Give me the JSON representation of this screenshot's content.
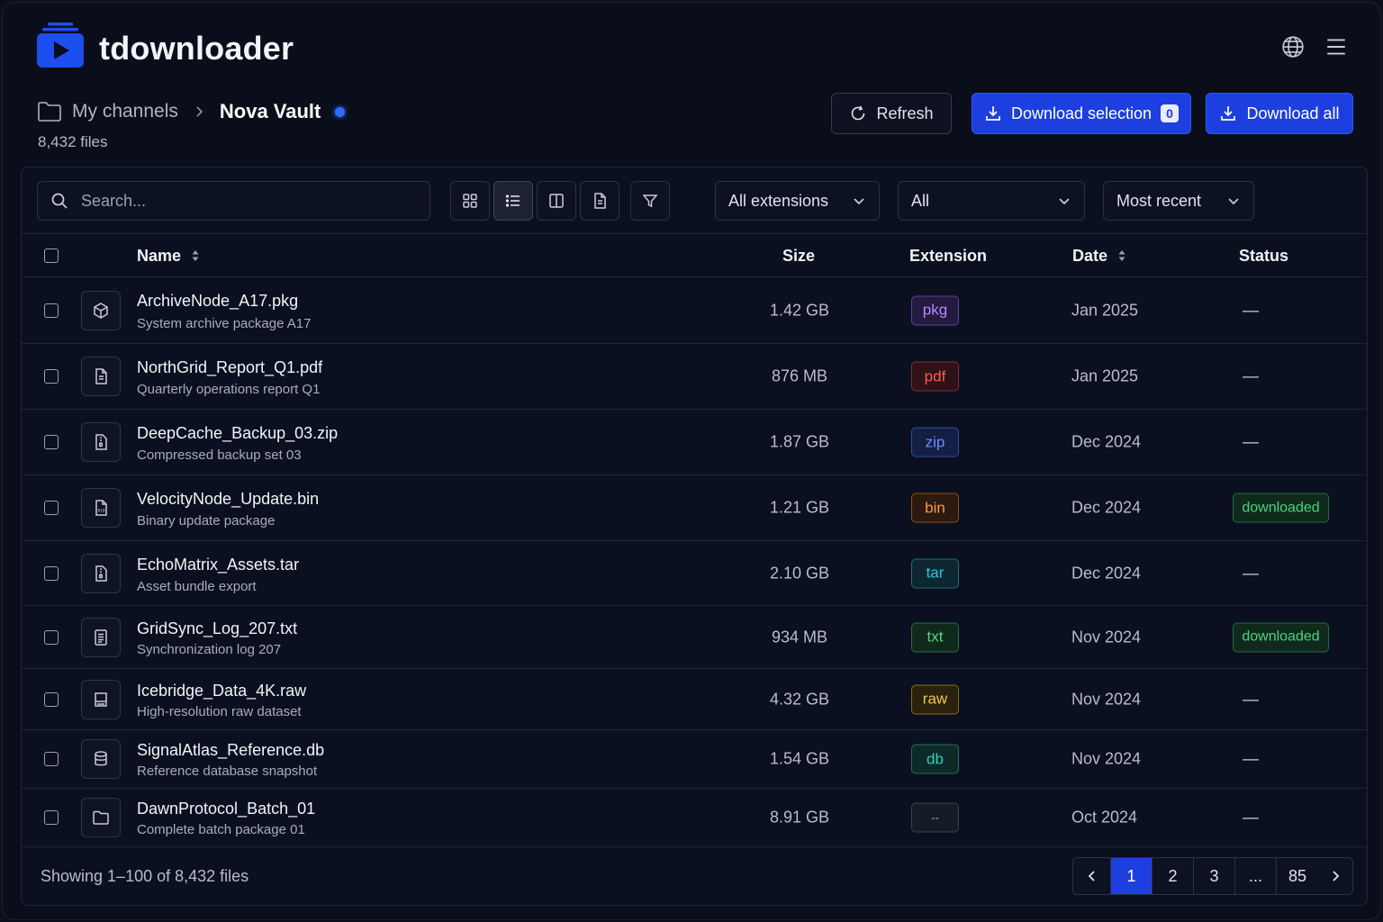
{
  "app": {
    "title": "tdownloader"
  },
  "breadcrumb": {
    "root": "My channels",
    "current": "Nova Vault",
    "file_count": "8,432 files"
  },
  "actions": {
    "refresh": "Refresh",
    "download_selection": "Download selection",
    "selection_count": "0",
    "download_all": "Download all"
  },
  "toolbar": {
    "search_placeholder": "Search...",
    "extension_filter": "All extensions",
    "status_filter": "All",
    "sort": "Most recent"
  },
  "table": {
    "headers": {
      "name": "Name",
      "size": "Size",
      "extension": "Extension",
      "date": "Date",
      "status": "Status"
    },
    "rows": [
      {
        "name": "ArchiveNode_A17.pkg",
        "desc": "System archive package A17",
        "size": "1.42 GB",
        "ext": "pkg",
        "date": "Jan 2025",
        "status": "—",
        "icon": "package-icon"
      },
      {
        "name": "NorthGrid_Report_Q1.pdf",
        "desc": "Quarterly operations report Q1",
        "size": "876 MB",
        "ext": "pdf",
        "date": "Jan 2025",
        "status": "—",
        "icon": "document-icon"
      },
      {
        "name": "DeepCache_Backup_03.zip",
        "desc": "Compressed backup set 03",
        "size": "1.87 GB",
        "ext": "zip",
        "date": "Dec 2024",
        "status": "—",
        "icon": "zip-file-icon"
      },
      {
        "name": "VelocityNode_Update.bin",
        "desc": "Binary update package",
        "size": "1.21 GB",
        "ext": "bin",
        "date": "Dec 2024",
        "status": "downloaded",
        "icon": "binary-file-icon"
      },
      {
        "name": "EchoMatrix_Assets.tar",
        "desc": "Asset bundle export",
        "size": "2.10 GB",
        "ext": "tar",
        "date": "Dec 2024",
        "status": "—",
        "icon": "archive-file-icon"
      },
      {
        "name": "GridSync_Log_207.txt",
        "desc": "Synchronization log 207",
        "size": "934 MB",
        "ext": "txt",
        "date": "Nov 2024",
        "status": "downloaded",
        "icon": "text-file-icon"
      },
      {
        "name": "Icebridge_Data_4K.raw",
        "desc": "High-resolution raw dataset",
        "size": "4.32 GB",
        "ext": "raw",
        "date": "Nov 2024",
        "status": "—",
        "icon": "drive-icon"
      },
      {
        "name": "SignalAtlas_Reference.db",
        "desc": "Reference database snapshot",
        "size": "1.54 GB",
        "ext": "db",
        "date": "Nov 2024",
        "status": "—",
        "icon": "database-icon"
      },
      {
        "name": "DawnProtocol_Batch_01",
        "desc": "Complete batch package 01",
        "size": "8.91 GB",
        "ext": "--",
        "date": "Oct 2024",
        "status": "—",
        "icon": "folder-icon"
      }
    ]
  },
  "ext_colors": {
    "pkg": {
      "fg": "#b589ff",
      "bg": "#241a3d",
      "border": "#5b3fa3"
    },
    "pdf": {
      "fg": "#ff5a5a",
      "bg": "#2e1216",
      "border": "#8a2a2f"
    },
    "zip": {
      "fg": "#6f8dff",
      "bg": "#151f44",
      "border": "#304aa8"
    },
    "bin": {
      "fg": "#ff9a3c",
      "bg": "#2c1a0e",
      "border": "#8a4f1c"
    },
    "tar": {
      "fg": "#2fc8e0",
      "bg": "#0d2630",
      "border": "#1e6e80"
    },
    "txt": {
      "fg": "#58d68d",
      "bg": "#0f2a1b",
      "border": "#23703f"
    },
    "raw": {
      "fg": "#f5c542",
      "bg": "#2a220c",
      "border": "#8a6d1a"
    },
    "db": {
      "fg": "#2fd0b8",
      "bg": "#0d2a28",
      "border": "#1f6e66"
    },
    "--": {
      "fg": "#a0a6b5",
      "bg": "#161b28",
      "border": "#3a4152"
    }
  },
  "footer": {
    "showing": "Showing 1–100 of 8,432 files",
    "pages": [
      "1",
      "2",
      "3",
      "...",
      "85"
    ],
    "current_page": "1"
  },
  "colors": {
    "accent": "#1d3fe0",
    "background": "#0a0e1b",
    "success": "#4ad17e"
  }
}
